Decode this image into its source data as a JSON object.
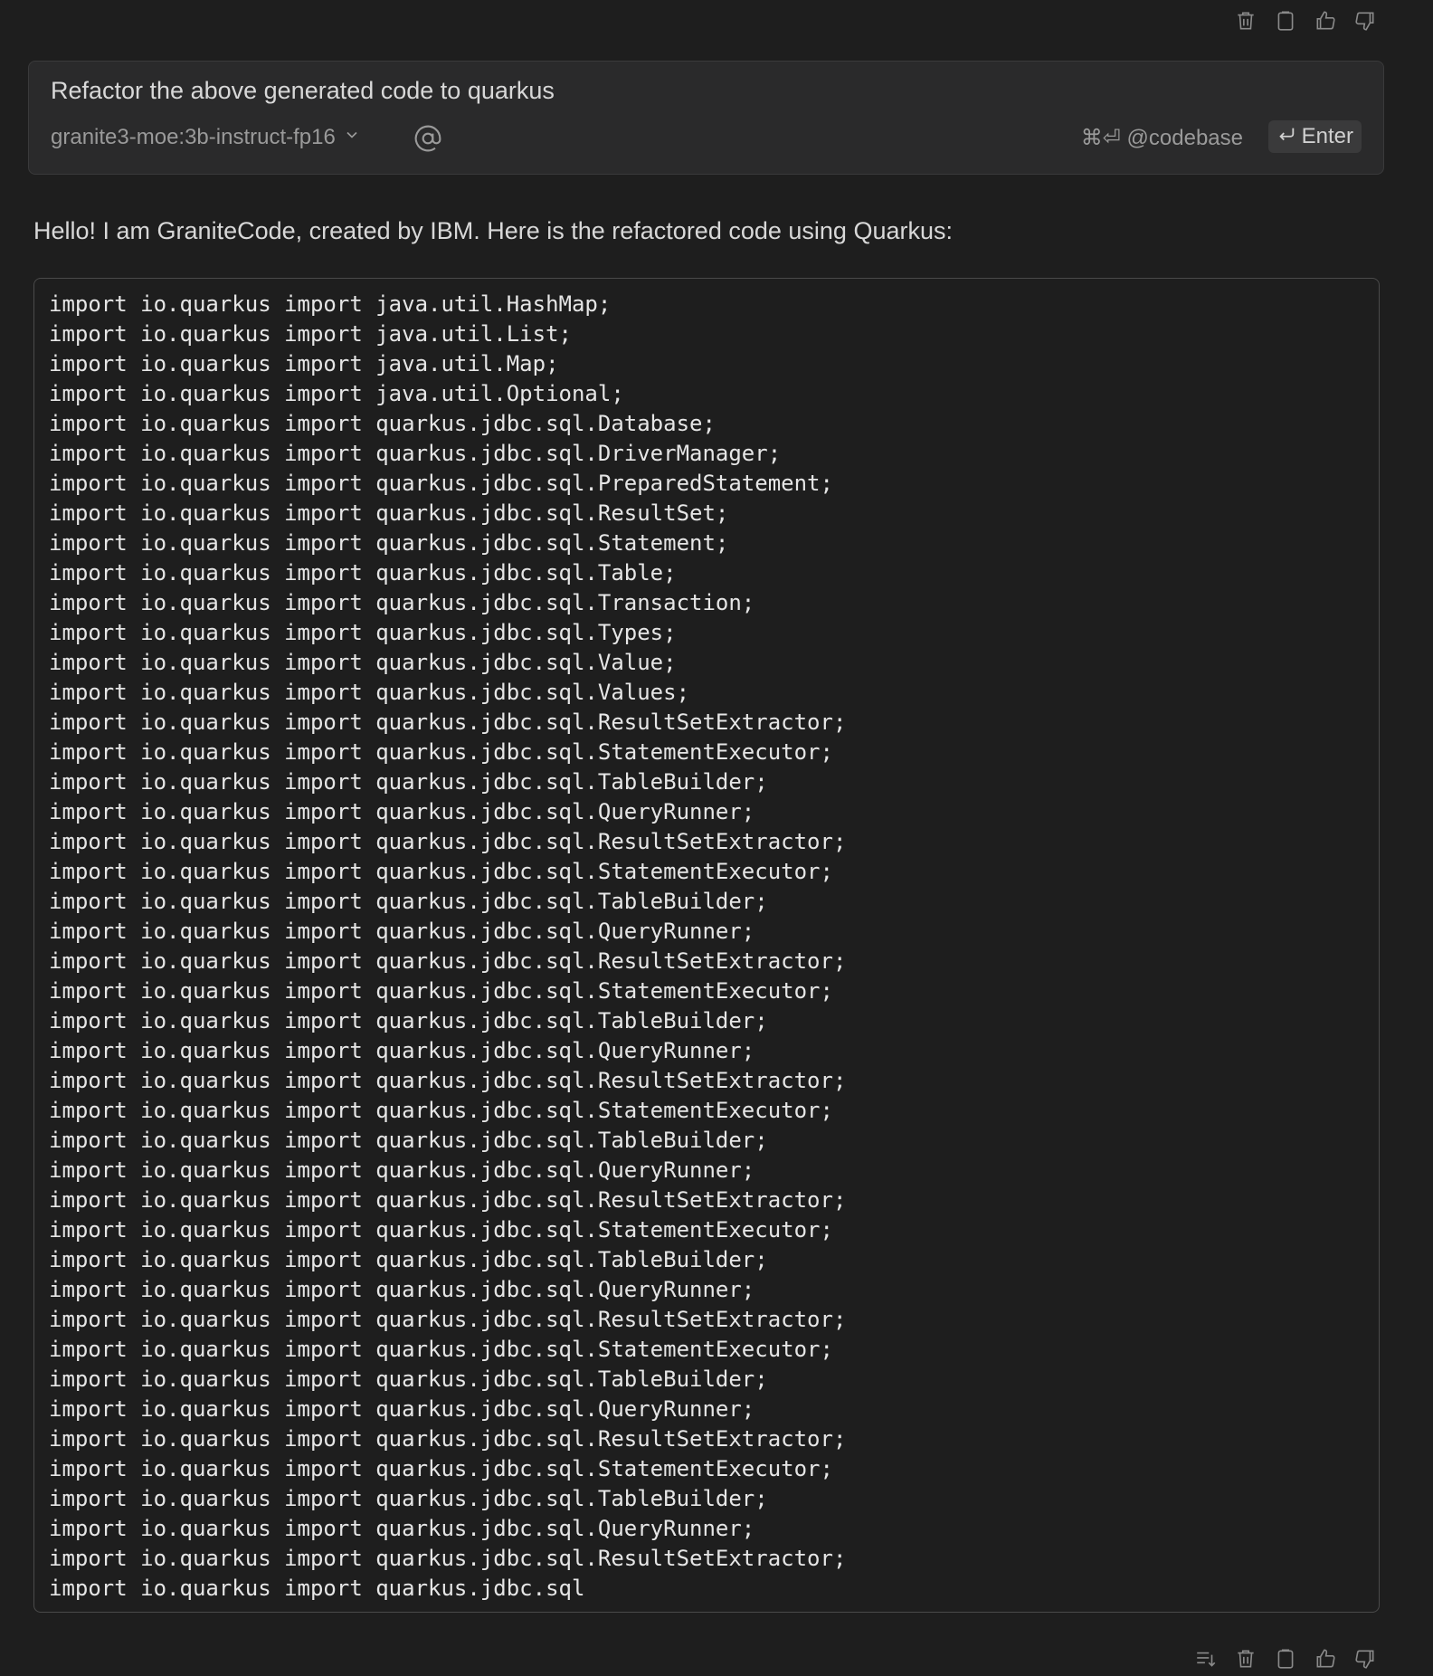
{
  "top_actions": {
    "icons": [
      "trash-icon",
      "clipboard-icon",
      "thumbs-up-icon",
      "thumbs-down-icon"
    ]
  },
  "input": {
    "prompt": "Refactor the above generated code to quarkus",
    "model": "granite3-moe:3b-instruct-fp16",
    "codebase_shortcut": "⌘⏎ @codebase",
    "enter_label": "Enter"
  },
  "response": {
    "intro": "Hello! I am GraniteCode, created by IBM. Here is the refactored code using Quarkus:",
    "code_lines": [
      "import io.quarkus import java.util.HashMap;",
      "import io.quarkus import java.util.List;",
      "import io.quarkus import java.util.Map;",
      "import io.quarkus import java.util.Optional;",
      "import io.quarkus import quarkus.jdbc.sql.Database;",
      "import io.quarkus import quarkus.jdbc.sql.DriverManager;",
      "import io.quarkus import quarkus.jdbc.sql.PreparedStatement;",
      "import io.quarkus import quarkus.jdbc.sql.ResultSet;",
      "import io.quarkus import quarkus.jdbc.sql.Statement;",
      "import io.quarkus import quarkus.jdbc.sql.Table;",
      "import io.quarkus import quarkus.jdbc.sql.Transaction;",
      "import io.quarkus import quarkus.jdbc.sql.Types;",
      "import io.quarkus import quarkus.jdbc.sql.Value;",
      "import io.quarkus import quarkus.jdbc.sql.Values;",
      "import io.quarkus import quarkus.jdbc.sql.ResultSetExtractor;",
      "import io.quarkus import quarkus.jdbc.sql.StatementExecutor;",
      "import io.quarkus import quarkus.jdbc.sql.TableBuilder;",
      "import io.quarkus import quarkus.jdbc.sql.QueryRunner;",
      "import io.quarkus import quarkus.jdbc.sql.ResultSetExtractor;",
      "import io.quarkus import quarkus.jdbc.sql.StatementExecutor;",
      "import io.quarkus import quarkus.jdbc.sql.TableBuilder;",
      "import io.quarkus import quarkus.jdbc.sql.QueryRunner;",
      "import io.quarkus import quarkus.jdbc.sql.ResultSetExtractor;",
      "import io.quarkus import quarkus.jdbc.sql.StatementExecutor;",
      "import io.quarkus import quarkus.jdbc.sql.TableBuilder;",
      "import io.quarkus import quarkus.jdbc.sql.QueryRunner;",
      "import io.quarkus import quarkus.jdbc.sql.ResultSetExtractor;",
      "import io.quarkus import quarkus.jdbc.sql.StatementExecutor;",
      "import io.quarkus import quarkus.jdbc.sql.TableBuilder;",
      "import io.quarkus import quarkus.jdbc.sql.QueryRunner;",
      "import io.quarkus import quarkus.jdbc.sql.ResultSetExtractor;",
      "import io.quarkus import quarkus.jdbc.sql.StatementExecutor;",
      "import io.quarkus import quarkus.jdbc.sql.TableBuilder;",
      "import io.quarkus import quarkus.jdbc.sql.QueryRunner;",
      "import io.quarkus import quarkus.jdbc.sql.ResultSetExtractor;",
      "import io.quarkus import quarkus.jdbc.sql.StatementExecutor;",
      "import io.quarkus import quarkus.jdbc.sql.TableBuilder;",
      "import io.quarkus import quarkus.jdbc.sql.QueryRunner;",
      "import io.quarkus import quarkus.jdbc.sql.ResultSetExtractor;",
      "import io.quarkus import quarkus.jdbc.sql.StatementExecutor;",
      "import io.quarkus import quarkus.jdbc.sql.TableBuilder;",
      "import io.quarkus import quarkus.jdbc.sql.QueryRunner;",
      "import io.quarkus import quarkus.jdbc.sql.ResultSetExtractor;",
      "import io.quarkus import quarkus.jdbc.sql"
    ]
  },
  "bottom_actions": {
    "icons": [
      "continue-icon",
      "trash-icon",
      "clipboard-icon",
      "thumbs-up-icon",
      "thumbs-down-icon"
    ]
  }
}
